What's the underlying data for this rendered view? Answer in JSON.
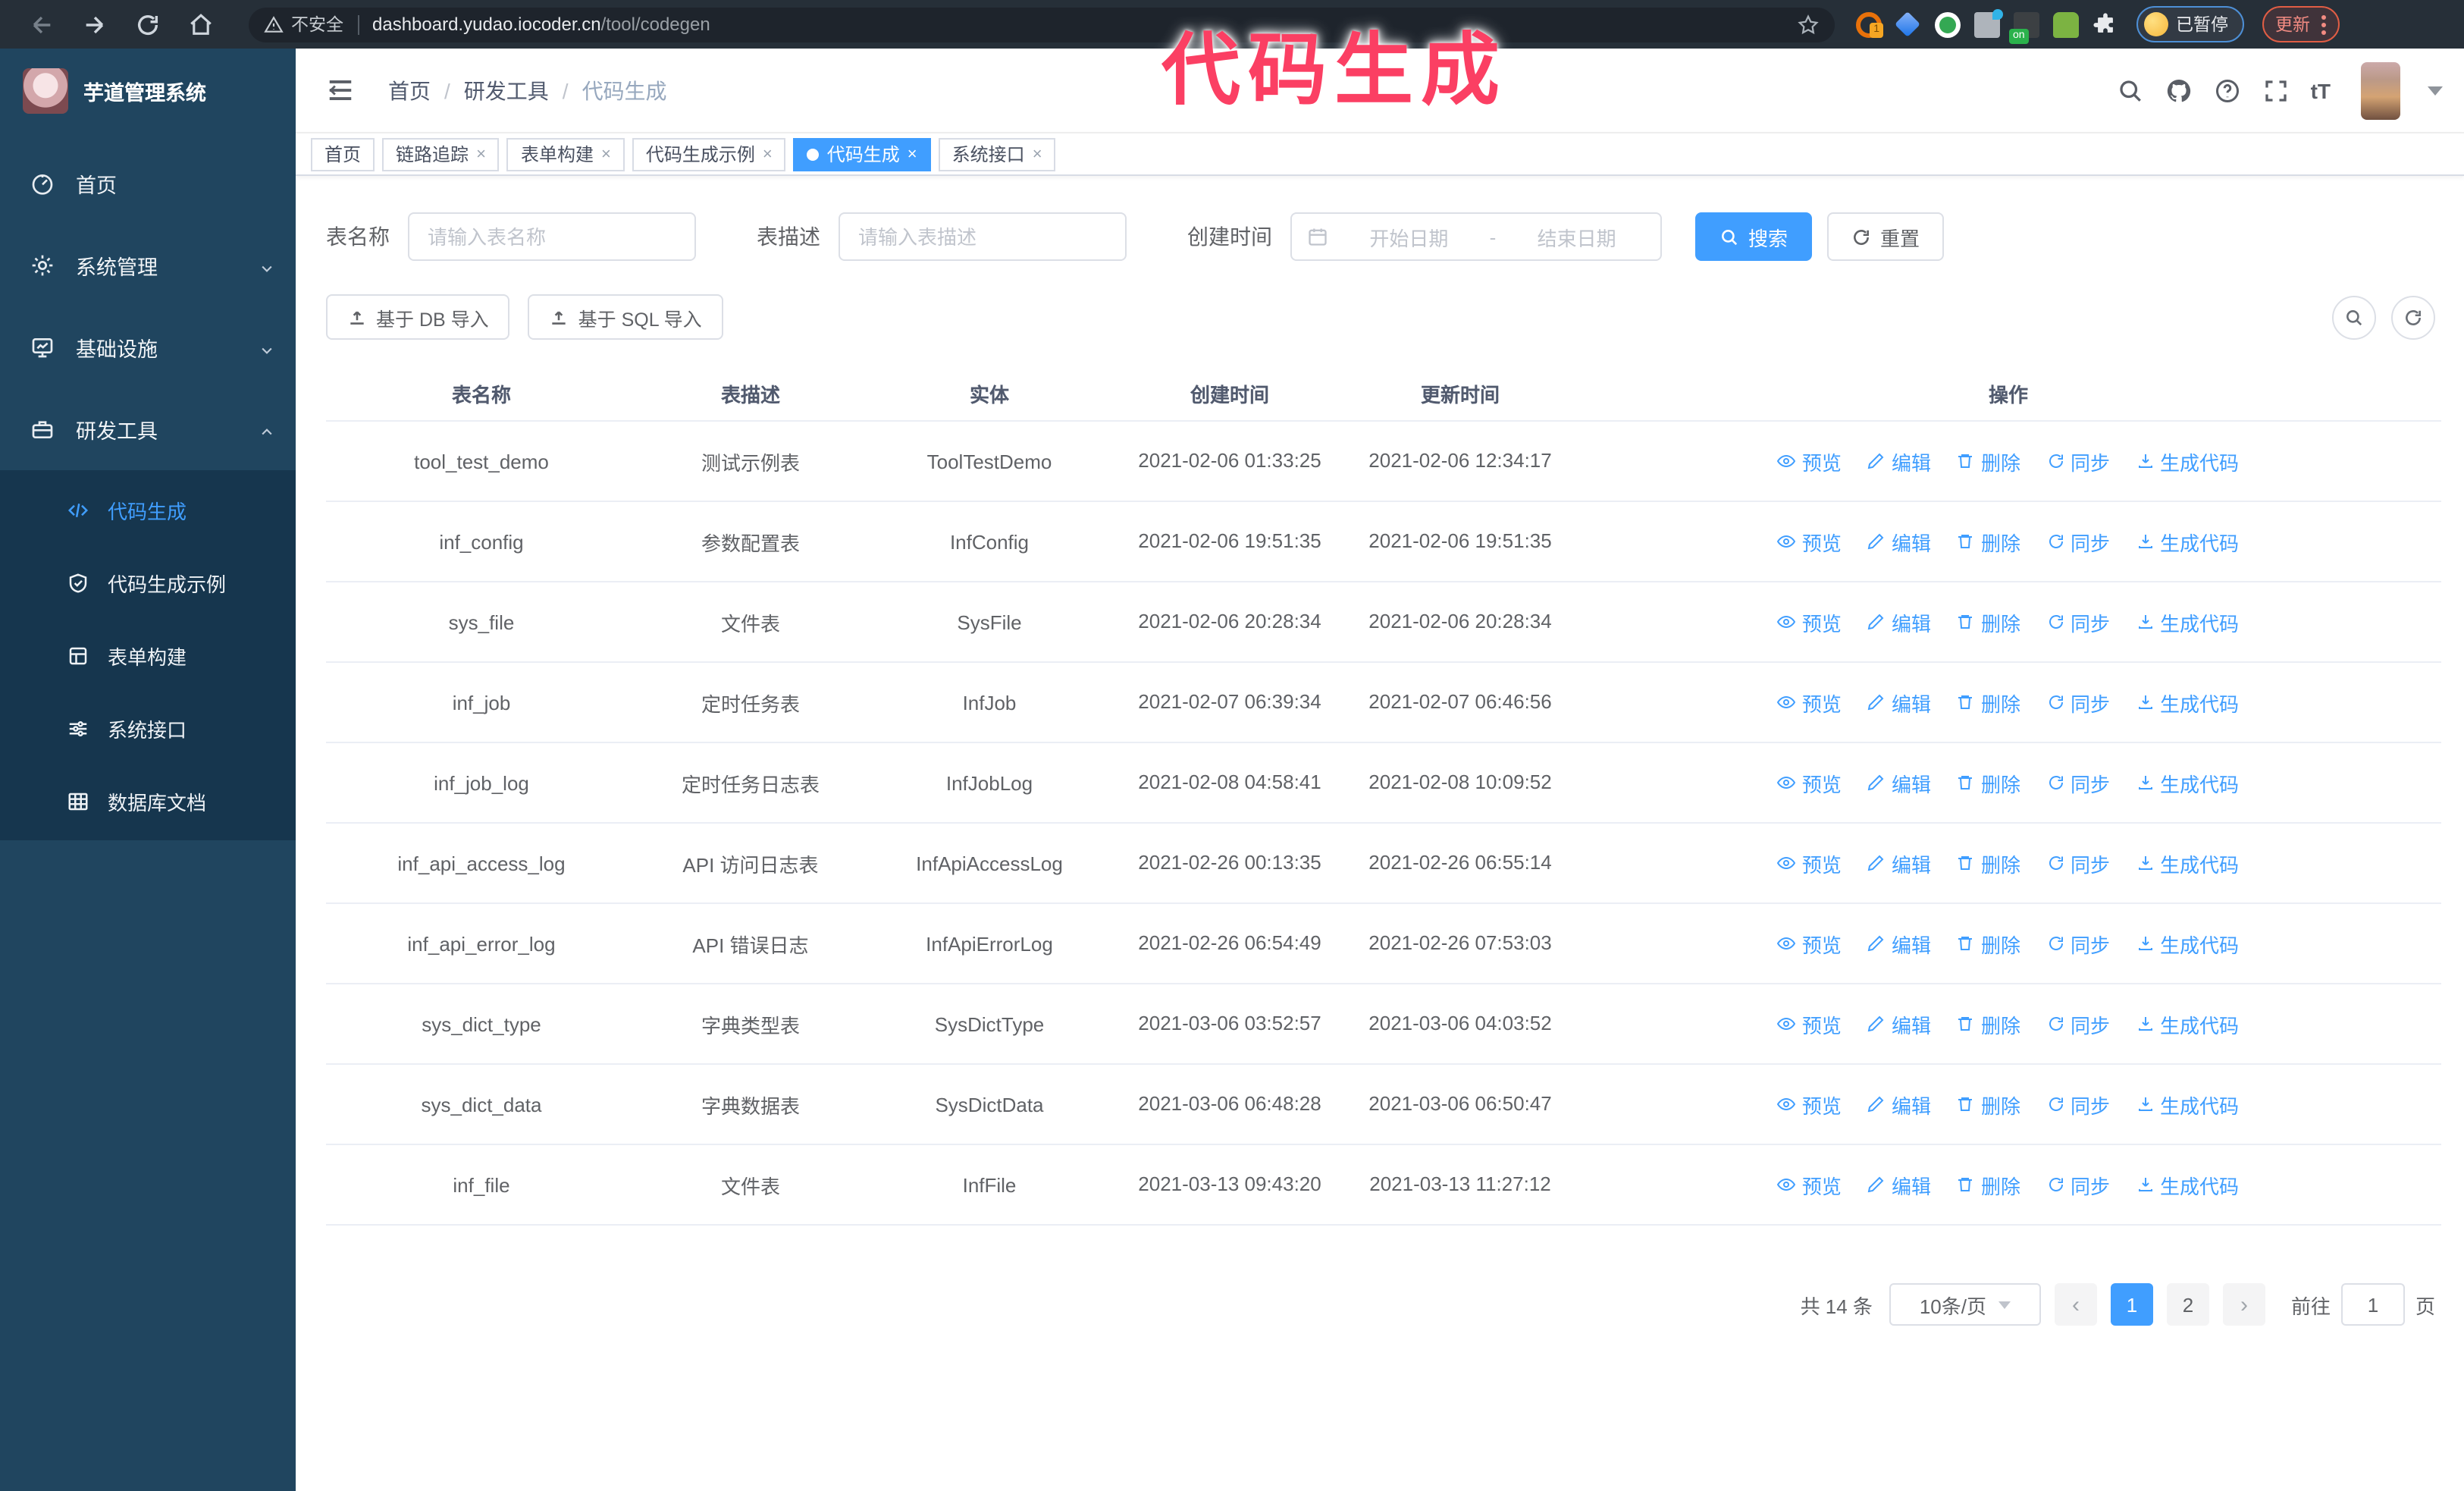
{
  "browser": {
    "security_label": "不安全",
    "url_host": "dashboard.yudao.iocoder.cn",
    "url_path": "/tool/codegen",
    "extension_badge": "1",
    "extension_on_badge": "on",
    "paused_label": "已暂停",
    "update_label": "更新"
  },
  "watermark": "代码生成",
  "sidebar": {
    "app_title": "芋道管理系统",
    "items": [
      {
        "label": "首页"
      },
      {
        "label": "系统管理"
      },
      {
        "label": "基础设施"
      },
      {
        "label": "研发工具"
      }
    ],
    "subitems": [
      {
        "label": "代码生成",
        "active": true
      },
      {
        "label": "代码生成示例"
      },
      {
        "label": "表单构建"
      },
      {
        "label": "系统接口"
      },
      {
        "label": "数据库文档"
      }
    ]
  },
  "breadcrumb": [
    "首页",
    "研发工具",
    "代码生成"
  ],
  "tabs": [
    {
      "label": "首页",
      "closable": false,
      "active": false
    },
    {
      "label": "链路追踪",
      "closable": true,
      "active": false
    },
    {
      "label": "表单构建",
      "closable": true,
      "active": false
    },
    {
      "label": "代码生成示例",
      "closable": true,
      "active": false
    },
    {
      "label": "代码生成",
      "closable": true,
      "active": true
    },
    {
      "label": "系统接口",
      "closable": true,
      "active": false
    }
  ],
  "filters": {
    "name_label": "表名称",
    "name_placeholder": "请输入表名称",
    "desc_label": "表描述",
    "desc_placeholder": "请输入表描述",
    "time_label": "创建时间",
    "start_placeholder": "开始日期",
    "range_separator": "-",
    "end_placeholder": "结束日期",
    "search_label": "搜索",
    "reset_label": "重置"
  },
  "toolbar": {
    "import_db_label": "基于 DB 导入",
    "import_sql_label": "基于 SQL 导入"
  },
  "table": {
    "columns": [
      "表名称",
      "表描述",
      "实体",
      "创建时间",
      "更新时间",
      "操作"
    ],
    "actions": [
      "预览",
      "编辑",
      "删除",
      "同步",
      "生成代码"
    ],
    "rows": [
      {
        "name": "tool_test_demo",
        "desc": "测试示例表",
        "entity": "ToolTestDemo",
        "created": "2021-02-06 01:33:25",
        "updated": "2021-02-06 12:34:17"
      },
      {
        "name": "inf_config",
        "desc": "参数配置表",
        "entity": "InfConfig",
        "created": "2021-02-06 19:51:35",
        "updated": "2021-02-06 19:51:35"
      },
      {
        "name": "sys_file",
        "desc": "文件表",
        "entity": "SysFile",
        "created": "2021-02-06 20:28:34",
        "updated": "2021-02-06 20:28:34"
      },
      {
        "name": "inf_job",
        "desc": "定时任务表",
        "entity": "InfJob",
        "created": "2021-02-07 06:39:34",
        "updated": "2021-02-07 06:46:56"
      },
      {
        "name": "inf_job_log",
        "desc": "定时任务日志表",
        "entity": "InfJobLog",
        "created": "2021-02-08 04:58:41",
        "updated": "2021-02-08 10:09:52"
      },
      {
        "name": "inf_api_access_log",
        "desc": "API 访问日志表",
        "entity": "InfApiAccessLog",
        "created": "2021-02-26 00:13:35",
        "updated": "2021-02-26 06:55:14"
      },
      {
        "name": "inf_api_error_log",
        "desc": "API 错误日志",
        "entity": "InfApiErrorLog",
        "created": "2021-02-26 06:54:49",
        "updated": "2021-02-26 07:53:03"
      },
      {
        "name": "sys_dict_type",
        "desc": "字典类型表",
        "entity": "SysDictType",
        "created": "2021-03-06 03:52:57",
        "updated": "2021-03-06 04:03:52"
      },
      {
        "name": "sys_dict_data",
        "desc": "字典数据表",
        "entity": "SysDictData",
        "created": "2021-03-06 06:48:28",
        "updated": "2021-03-06 06:50:47"
      },
      {
        "name": "inf_file",
        "desc": "文件表",
        "entity": "InfFile",
        "created": "2021-03-13 09:43:20",
        "updated": "2021-03-13 11:27:12"
      }
    ]
  },
  "pagination": {
    "total_label": "共 14 条",
    "page_size": "10条/页",
    "prev_label": "‹",
    "pages": [
      "1",
      "2"
    ],
    "active_page": "1",
    "next_label": "›",
    "goto_label": "前往",
    "goto_value": "1",
    "page_label": "页"
  },
  "colors": {
    "accent": "#409eff",
    "sidebar_bg": "#20455f",
    "submenu_bg": "#16364e",
    "watermark_pink": "#fb3f63"
  }
}
